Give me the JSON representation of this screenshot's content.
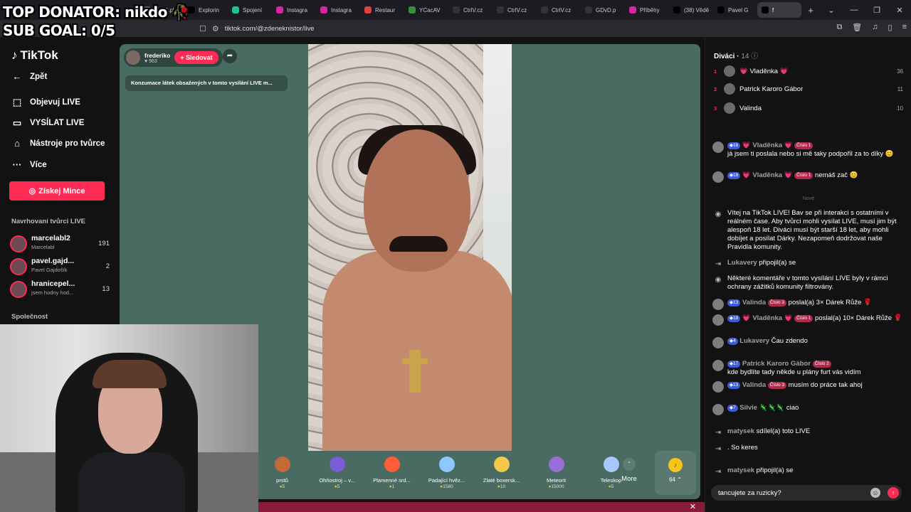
{
  "overlay": {
    "line1": "TOP DONATOR: nikdo 🥀",
    "line2": "SUB GOAL: 0/5"
  },
  "browser": {
    "tabs": [
      {
        "label": "7Nu2.pl",
        "color": "#555"
      },
      {
        "label": "Explorin",
        "color": "#000"
      },
      {
        "label": "Spojení",
        "color": "#1ec28b"
      },
      {
        "label": "Instagra",
        "color": "#d6249f"
      },
      {
        "label": "Instagra",
        "color": "#d6249f"
      },
      {
        "label": "Restaur",
        "color": "#e04040"
      },
      {
        "label": "YCacAV",
        "color": "#3a8f3a"
      },
      {
        "label": "CtrlV.cz",
        "color": "#333"
      },
      {
        "label": "CtrlV.cz",
        "color": "#333"
      },
      {
        "label": "CtrlV.cz",
        "color": "#333"
      },
      {
        "label": "GDvD.p",
        "color": "#333"
      },
      {
        "label": "Příběhy",
        "color": "#d6249f"
      },
      {
        "label": "(38) Vědě",
        "color": "#000"
      },
      {
        "label": "Pavel G",
        "color": "#000"
      },
      {
        "label": "f",
        "color": "#000"
      }
    ],
    "url": "tiktok.com/@zdeneknistor/live"
  },
  "sidebar": {
    "logo": "TikTok",
    "back": "Zpět",
    "nav": [
      {
        "label": "Objevuj LIVE",
        "icon": "⬚"
      },
      {
        "label": "VYSÍLAT LIVE",
        "icon": "▭"
      },
      {
        "label": "Nástroje pro tvůrce",
        "icon": "⌂"
      },
      {
        "label": "Více",
        "icon": "···"
      }
    ],
    "coins_button": "Získej Mince",
    "suggested_title": "Navrhovaní tvůrci LIVE",
    "creators": [
      {
        "name": "marcelabl2",
        "sub": "Marcelabl",
        "count": "191"
      },
      {
        "name": "pavel.gajd...",
        "sub": "Pavel Gajdošík",
        "count": "2"
      },
      {
        "name": "hranicepel...",
        "sub": "jsem hodny hod...",
        "count": "13"
      }
    ],
    "company": "Společnost"
  },
  "live": {
    "host_name": "frederiko",
    "host_viewers": "963",
    "follow": "+ Sledovat",
    "notice": "Konzumace látek obsažených v tomto vysílání LIVE m...",
    "gifts": [
      {
        "name": "prstů",
        "price": "5",
        "color": "#c46a3a"
      },
      {
        "name": "Ohňostroj – v...",
        "price": "5",
        "color": "#7a5cd6"
      },
      {
        "name": "Plamenné srd...",
        "price": "1",
        "color": "#ff5c3a"
      },
      {
        "name": "Padající hvěz...",
        "price": "1580",
        "color": "#8ec8ff"
      },
      {
        "name": "Zlaté boxersk...",
        "price": "10",
        "color": "#f2c84b"
      },
      {
        "name": "Meteorit",
        "price": "15000",
        "color": "#9a6dd6"
      },
      {
        "name": "Teleskop",
        "price": "5",
        "color": "#a6c8ff"
      }
    ],
    "more": "More",
    "balance": "64"
  },
  "chat": {
    "title": "Diváci",
    "viewer_count": "14",
    "top_viewers": [
      {
        "rank": "1",
        "name": "💗 Vladěnka 💗",
        "score": "36"
      },
      {
        "rank": "2",
        "name": "Patrick Karoro Gábor",
        "score": "11"
      },
      {
        "rank": "3",
        "name": "Valinda",
        "score": "10"
      }
    ],
    "new_label": "Nové",
    "messages": [
      {
        "badge": "18",
        "user": "💗 Vladěnka 💗",
        "rank_badge": "Číslo 1",
        "text": "já jsem ti poslala nebo si mě taky podpořil za to díky 😊"
      },
      {
        "badge": "18",
        "user": "💗 Vladěnka 💗",
        "rank_badge": "Číslo 1",
        "text": "nemáš zač 😊"
      },
      {
        "text": "Vítej na TikTok LIVE! Bav se při interakci s ostatními v reálném čase. Aby tvůrci mohli vysílat LIVE, musí jim být alespoň 18 let. Diváci musí být starší 18 let, aby mohli dobíjet a posílat Dárky. Nezapomeň dodržovat naše Pravidla komunity."
      },
      {
        "user": "Lukavery",
        "text": "připojil(a) se"
      },
      {
        "text": "Některé komentáře v tomto vysílání LIVE byly v rámci ochrany zážitků komunity filtrovány."
      },
      {
        "badge": "13",
        "user": "Valinda",
        "rank_badge": "Číslo 3",
        "text": "poslal(a) 3× Dárek Růže 🌹"
      },
      {
        "badge": "18",
        "user": "💗 Vladěnka 💗",
        "rank_badge": "Číslo 1",
        "text": "poslal(a) 10× Dárek Růže 🌹"
      },
      {
        "badge": "4",
        "user": "Lukavery",
        "text": "Čau zdendo"
      },
      {
        "badge": "17",
        "user": "Patrick Karoro Gábor",
        "rank_badge": "Číslo 2",
        "text": "kde bydlíte tady někde u plány furt vás vidím"
      },
      {
        "badge": "13",
        "user": "Valinda",
        "rank_badge": "Číslo 3",
        "text": "musím do práce tak ahoj"
      },
      {
        "badge": "7",
        "user": "Silvie 🦎🦎🦎",
        "text": "ciao"
      },
      {
        "user": "matysek",
        "text": "sdílel(a) toto LIVE"
      },
      {
        "user": ".",
        "text": "So keres"
      },
      {
        "user": "matysek",
        "text": "připojil(a) se"
      }
    ],
    "input_value": "tancujete za ruzicky?"
  }
}
